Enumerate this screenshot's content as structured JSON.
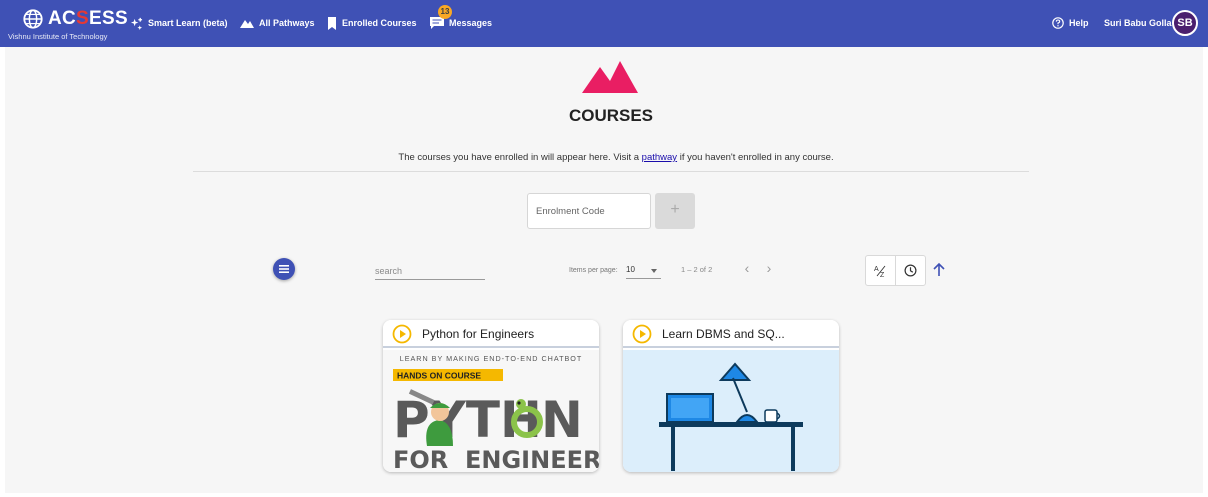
{
  "header": {
    "logo_text_1": "AC",
    "logo_text_2": "S",
    "logo_text_3": "ESS",
    "institute": "Vishnu Institute of Technology",
    "nav": {
      "smart_learn": "Smart Learn (beta)",
      "all_pathways": "All Pathways",
      "enrolled_courses": "Enrolled Courses",
      "messages": "Messages",
      "messages_count": "13",
      "help": "Help"
    },
    "user_name": "Suri Babu Golla",
    "avatar_initials": "SB"
  },
  "page": {
    "title": "COURSES",
    "intro_before": "The courses you have enrolled in will appear here. Visit a ",
    "intro_link": "pathway",
    "intro_after": " if you haven't enrolled in any course."
  },
  "enrol": {
    "placeholder": "Enrolment Code",
    "add_label": "+"
  },
  "toolbar": {
    "search_placeholder": "search",
    "items_per_page_label": "Items per page:",
    "items_per_page_value": "10",
    "range_text": "1 – 2 of 2",
    "prev_label": "‹",
    "next_label": "›"
  },
  "courses": [
    {
      "title": "Python for Engineers",
      "banner_top": "LEARN BY MAKING END-TO-END CHATBOT",
      "banner_tag": "HANDS ON COURSE",
      "banner_big_1": "PYTH",
      "banner_big_2": "N",
      "banner_bottom_1": "FOR",
      "banner_bottom_2": "ENGINEERS"
    },
    {
      "title": "Learn DBMS and SQ..."
    }
  ],
  "colors": {
    "header_bg": "#3f51b5",
    "accent_pink": "#e91e63",
    "play_yellow": "#f5b800",
    "dbms_bg": "#dceefb"
  }
}
